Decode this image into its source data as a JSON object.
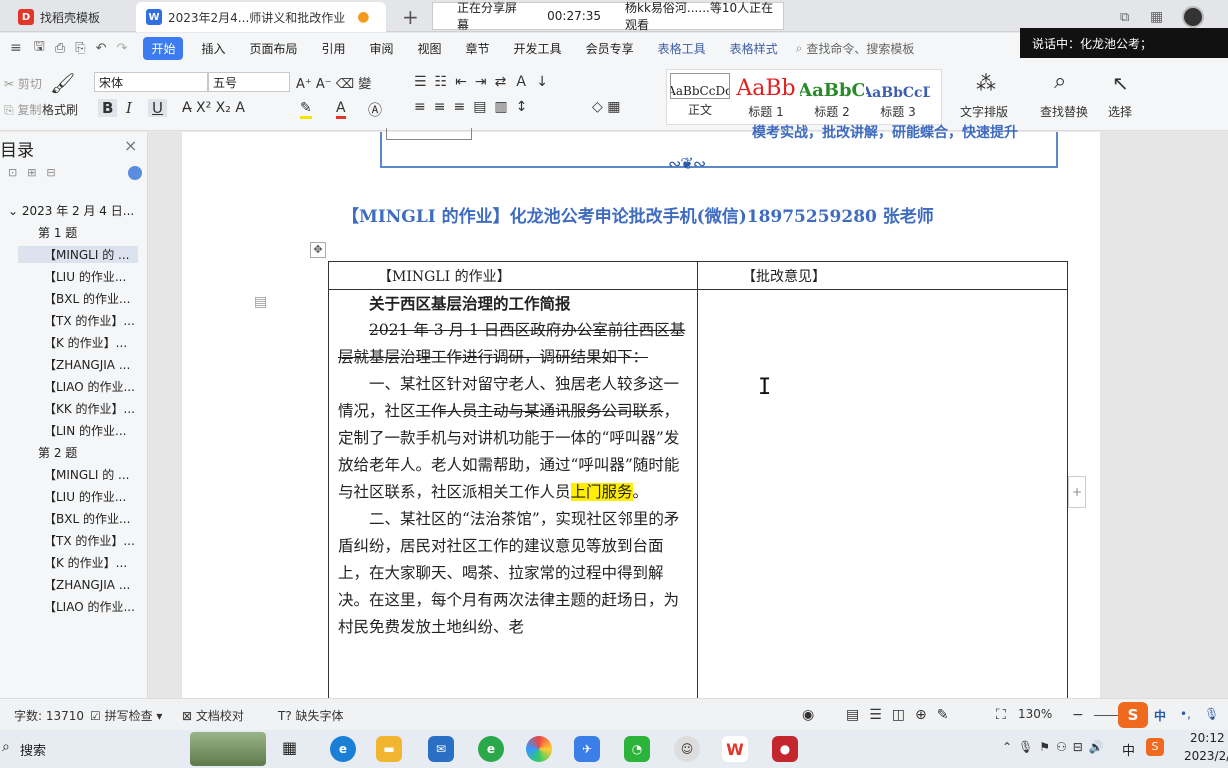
{
  "tabs": [
    {
      "label": "找稻壳模板"
    },
    {
      "label": "2023年2月4...师讲义和批改作业"
    }
  ],
  "share_banner": {
    "status": "正在分享屏幕",
    "time": "00:27:35",
    "viewers": "杨kk易俗河......等10人正在观看"
  },
  "speaker": "说话中：化龙池公考；",
  "menu": {
    "items": [
      "开始",
      "插入",
      "页面布局",
      "引用",
      "审阅",
      "视图",
      "章节",
      "开发工具",
      "会员专享",
      "表格工具",
      "表格样式"
    ],
    "search_placeholder": "查找命令、搜索模板"
  },
  "ribbon": {
    "cut": "剪切",
    "copy": "复制",
    "format_painter": "格式刷",
    "font_name": "宋体",
    "font_size": "五号",
    "styles": [
      {
        "sample": "AaBbCcDd",
        "label": "正文"
      },
      {
        "sample": "AaBb",
        "label": "标题 1"
      },
      {
        "sample": "AaBbC",
        "label": "标题 2"
      },
      {
        "sample": "AaBbCcD",
        "label": "标题 3"
      }
    ],
    "text_layout": "文字排版",
    "find_replace": "查找替换",
    "select": "选择"
  },
  "nav": {
    "title": "目录",
    "root": "2023 年 2 月 4 日...",
    "group1": "第 1 题",
    "group1_items": [
      "【MINGLI 的 ...",
      "【LIU 的作业...",
      "【BXL 的作业...",
      "【TX 的作业】...",
      "【K 的作业】...",
      "【ZHANGJIA ...",
      "【LIAO 的作业...",
      "【KK 的作业】...",
      "【LIN 的作业..."
    ],
    "group2": "第 2 题",
    "group2_items": [
      "【MINGLI 的 ...",
      "【LIU 的作业...",
      "【BXL 的作业...",
      "【TX 的作业】...",
      "【K 的作业】...",
      "【ZHANGJIA ...",
      "【LIAO 的作业..."
    ]
  },
  "doc": {
    "banner_text": "模考实战，批改讲解，研能蝶合，快速提升",
    "title": "【MINGLI 的作业】化龙池公考申论批改手机(微信)18975259280 张老师",
    "col1_header": "【MINGLI 的作业】",
    "col2_header": "【批改意见】",
    "heading": "关于西区基层治理的工作简报",
    "p1_strike": "2021 年 3 月 1 日西区政府办公室前往西区基层就基层治理工作进行调研，调研结果如下：",
    "p2_a": "一、某社区针对留守老人、独居老人较多这一情况，社区",
    "p2_strike": "工作人员主动与某通讯服务公司联系",
    "p2_b": "，定制了一款手机与对讲机功能于一体的“呼叫器”发放给老年人。老人如需帮助，通过“呼叫器”随时能与社区联系，社区派相关工作人员",
    "p2_hl": "上门服务",
    "p2_end": "。",
    "p3": "二、某社区的“法治茶馆”，实现社区邻里的矛盾纠纷，居民对社区工作的建议意见等放到台面上，在大家聊天、喝茶、拉家常的过程中得到解决。在这里，每个月有两次法律主题的赶场日，为村民免费发放土地纠纷、老"
  },
  "status": {
    "word_count": "字数: 13710",
    "spell_check": "拼写检查",
    "doc_check": "文档校对",
    "missing_font": "缺失字体",
    "zoom": "130%"
  },
  "taskbar": {
    "search": "搜索",
    "time": "20:12",
    "date": "2023/2/",
    "ime": "中"
  }
}
